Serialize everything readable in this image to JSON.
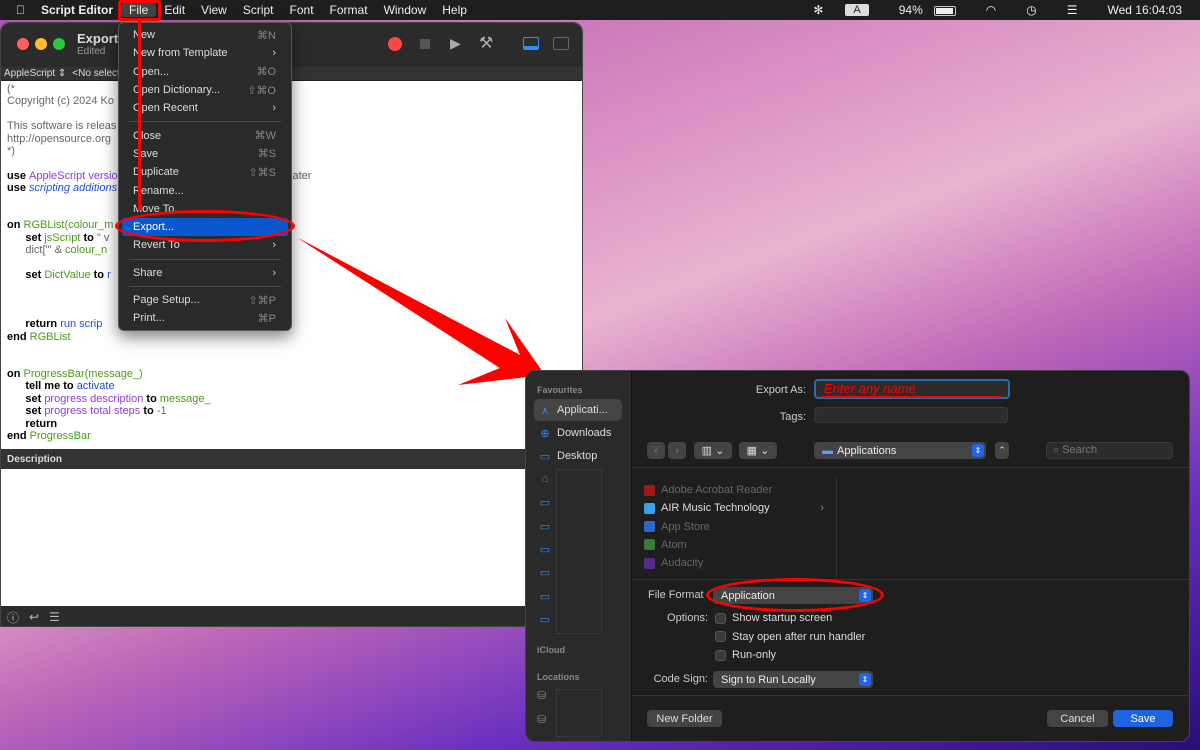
{
  "menubar": {
    "app": "Script Editor",
    "items": [
      "File",
      "Edit",
      "View",
      "Script",
      "Font",
      "Format",
      "Window",
      "Help"
    ],
    "battery": "94%",
    "battery_level": 94,
    "input_source": "A",
    "clock": "Wed 16:04:03"
  },
  "editor": {
    "title": "ExportC",
    "subtitle": "Edited",
    "language": "AppleScript ⇕",
    "selector": "<No selecte",
    "code": [
      [
        [
          "cm",
          "(*"
        ]
      ],
      [
        [
          "cm",
          "Copyright (c) 2024 Ko"
        ]
      ],
      [
        [
          "cm",
          ""
        ]
      ],
      [
        [
          "cm",
          "This software is releas"
        ]
      ],
      [
        [
          "cm",
          "http://opensource.org"
        ]
      ],
      [
        [
          "cm",
          "*)"
        ]
      ],
      [
        [
          "cm",
          ""
        ]
      ],
      [
        [
          "kw",
          "use "
        ],
        [
          "pu",
          "AppleScript versio"
        ],
        [
          "cm",
          "                                              13) or later"
        ]
      ],
      [
        [
          "kw",
          "use "
        ],
        [
          "it",
          "scripting additions"
        ]
      ],
      [
        [
          "cm",
          ""
        ]
      ],
      [
        [
          "cm",
          ""
        ]
      ],
      [
        [
          "kw",
          "on "
        ],
        [
          "gr",
          "RGBList(colour_m"
        ]
      ],
      [
        [
          "cm",
          "      "
        ],
        [
          "kw",
          "set "
        ],
        [
          "gr",
          "jsScript "
        ],
        [
          "kw",
          "to "
        ],
        [
          "cm",
          "\" v"
        ]
      ],
      [
        [
          "cm",
          "      dict['\" & "
        ],
        [
          "gr",
          "colour_n"
        ]
      ],
      [
        [
          "cm",
          ""
        ]
      ],
      [
        [
          "cm",
          "      "
        ],
        [
          "kw",
          "set "
        ],
        [
          "gr",
          "DictValue "
        ],
        [
          "kw",
          "to "
        ],
        [
          "bl",
          "r"
        ]
      ],
      [
        [
          "cm",
          ""
        ]
      ],
      [
        [
          "cm",
          ""
        ]
      ],
      [
        [
          "cm",
          ""
        ]
      ],
      [
        [
          "cm",
          "      "
        ],
        [
          "kw",
          "return "
        ],
        [
          "bl",
          "run scrip"
        ]
      ],
      [
        [
          "kw",
          "end "
        ],
        [
          "gr",
          "RGBList"
        ]
      ],
      [
        [
          "cm",
          ""
        ]
      ],
      [
        [
          "cm",
          ""
        ]
      ],
      [
        [
          "kw",
          "on "
        ],
        [
          "gr",
          "ProgressBar(message_)"
        ]
      ],
      [
        [
          "cm",
          "      "
        ],
        [
          "kw",
          "tell me to "
        ],
        [
          "bl",
          "activate"
        ]
      ],
      [
        [
          "cm",
          "      "
        ],
        [
          "kw",
          "set "
        ],
        [
          "pu",
          "progress description "
        ],
        [
          "kw",
          "to "
        ],
        [
          "gr",
          "message_"
        ]
      ],
      [
        [
          "cm",
          "      "
        ],
        [
          "kw",
          "set "
        ],
        [
          "pu",
          "progress total steps "
        ],
        [
          "kw",
          "to "
        ],
        [
          "cm",
          "-1"
        ]
      ],
      [
        [
          "cm",
          "      "
        ],
        [
          "kw",
          "return"
        ]
      ],
      [
        [
          "kw",
          "end "
        ],
        [
          "gr",
          "ProgressBar"
        ]
      ]
    ],
    "description_label": "Description"
  },
  "file_menu": {
    "groups": [
      [
        {
          "label": "New",
          "shortcut": "⌘N"
        },
        {
          "label": "New from Template",
          "submenu": true
        },
        {
          "label": "Open...",
          "shortcut": "⌘O"
        },
        {
          "label": "Open Dictionary...",
          "shortcut": "⇧⌘O"
        },
        {
          "label": "Open Recent",
          "submenu": true
        }
      ],
      [
        {
          "label": "Close",
          "shortcut": "⌘W"
        },
        {
          "label": "Save",
          "shortcut": "⌘S"
        },
        {
          "label": "Duplicate",
          "shortcut": "⇧⌘S"
        },
        {
          "label": "Rename..."
        },
        {
          "label": "Move To..."
        },
        {
          "label": "Export...",
          "selected": true
        },
        {
          "label": "Revert To",
          "submenu": true
        }
      ],
      [
        {
          "label": "Share",
          "submenu": true
        }
      ],
      [
        {
          "label": "Page Setup...",
          "shortcut": "⇧⌘P"
        },
        {
          "label": "Print...",
          "shortcut": "⌘P"
        }
      ]
    ]
  },
  "dialog": {
    "sidebar": {
      "favourites": "Favourites",
      "items": [
        "Applicati...",
        "Downloads",
        "Desktop"
      ],
      "icloud": "iCloud",
      "locations": "Locations"
    },
    "export_as_label": "Export As:",
    "export_as_value": "Enter any name",
    "tags_label": "Tags:",
    "location": "Applications",
    "search_placeholder": "Search",
    "files": [
      {
        "name": "Adobe Acrobat Reader",
        "color": "#a01818",
        "dim": true
      },
      {
        "name": "AIR Music Technology",
        "color": "#3aa0f0",
        "dim": false,
        "folder": true
      },
      {
        "name": "App Store",
        "color": "#2a6ad0",
        "dim": true
      },
      {
        "name": "Atom",
        "color": "#3a7a3a",
        "dim": true
      },
      {
        "name": "Audacity",
        "color": "#5a2a8a",
        "dim": true
      }
    ],
    "file_format_label": "File Format",
    "file_format": "Application",
    "options_label": "Options:",
    "options": [
      {
        "label": "Show startup screen",
        "checked": false
      },
      {
        "label": "Stay open after run handler",
        "checked": false
      },
      {
        "label": "Run-only",
        "checked": false
      }
    ],
    "code_sign_label": "Code Sign:",
    "code_sign": "Sign to Run Locally",
    "new_folder": "New Folder",
    "cancel": "Cancel",
    "save": "Save"
  },
  "colors": {
    "accent": "#0a58d0",
    "annotation": "#ff0000"
  }
}
